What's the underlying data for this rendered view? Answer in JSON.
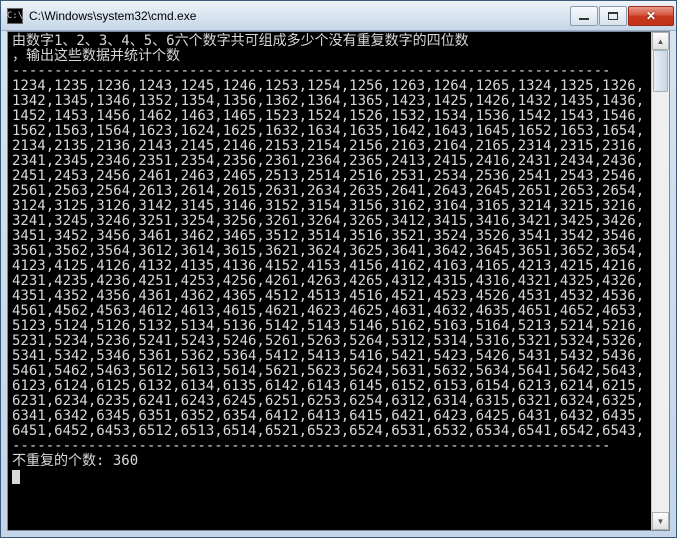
{
  "window": {
    "icon_label": "C:\\",
    "title": "C:\\Windows\\system32\\cmd.exe"
  },
  "console": {
    "prompt_line1": "由数字1、2、3、4、5、6六个数字共可组成多少个没有重复数字的四位数",
    "prompt_line2": "，输出这些数据并统计个数",
    "separator": "-----------------------------------------------------------------------",
    "numbers": "1234,1235,1236,1243,1245,1246,1253,1254,1256,1263,1264,1265,1324,1325,1326,1342,1345,1346,1352,1354,1356,1362,1364,1365,1423,1425,1426,1432,1435,1436,1452,1453,1456,1462,1463,1465,1523,1524,1526,1532,1534,1536,1542,1543,1546,1562,1563,1564,1623,1624,1625,1632,1634,1635,1642,1643,1645,1652,1653,1654,2134,2135,2136,2143,2145,2146,2153,2154,2156,2163,2164,2165,2314,2315,2316,2341,2345,2346,2351,2354,2356,2361,2364,2365,2413,2415,2416,2431,2434,2436,2451,2453,2456,2461,2463,2465,2513,2514,2516,2531,2534,2536,2541,2543,2546,2561,2563,2564,2613,2614,2615,2631,2634,2635,2641,2643,2645,2651,2653,2654,3124,3125,3126,3142,3145,3146,3152,3154,3156,3162,3164,3165,3214,3215,3216,3241,3245,3246,3251,3254,3256,3261,3264,3265,3412,3415,3416,3421,3425,3426,3451,3452,3456,3461,3462,3465,3512,3514,3516,3521,3524,3526,3541,3542,3546,3561,3562,3564,3612,3614,3615,3621,3624,3625,3641,3642,3645,3651,3652,3654,4123,4125,4126,4132,4135,4136,4152,4153,4156,4162,4163,4165,4213,4215,4216,4231,4235,4236,4251,4253,4256,4261,4263,4265,4312,4315,4316,4321,4325,4326,4351,4352,4356,4361,4362,4365,4512,4513,4516,4521,4523,4526,4531,4532,4536,4561,4562,4563,4612,4613,4615,4621,4623,4625,4631,4632,4635,4651,4652,4653,5123,5124,5126,5132,5134,5136,5142,5143,5146,5162,5163,5164,5213,5214,5216,5231,5234,5236,5241,5243,5246,5261,5263,5264,5312,5314,5316,5321,5324,5326,5341,5342,5346,5361,5362,5364,5412,5413,5416,5421,5423,5426,5431,5432,5436,5461,5462,5463,5612,5613,5614,5621,5623,5624,5631,5632,5634,5641,5642,5643,6123,6124,6125,6132,6134,6135,6142,6143,6145,6152,6153,6154,6213,6214,6215,6231,6234,6235,6241,6243,6245,6251,6253,6254,6312,6314,6315,6321,6324,6325,6341,6342,6345,6351,6352,6354,6412,6413,6415,6421,6423,6425,6431,6432,6435,6451,6452,6453,6512,6513,6514,6521,6523,6524,6531,6532,6534,6541,6542,6543,",
    "result_label": "不重复的个数: ",
    "result_value": "360"
  }
}
